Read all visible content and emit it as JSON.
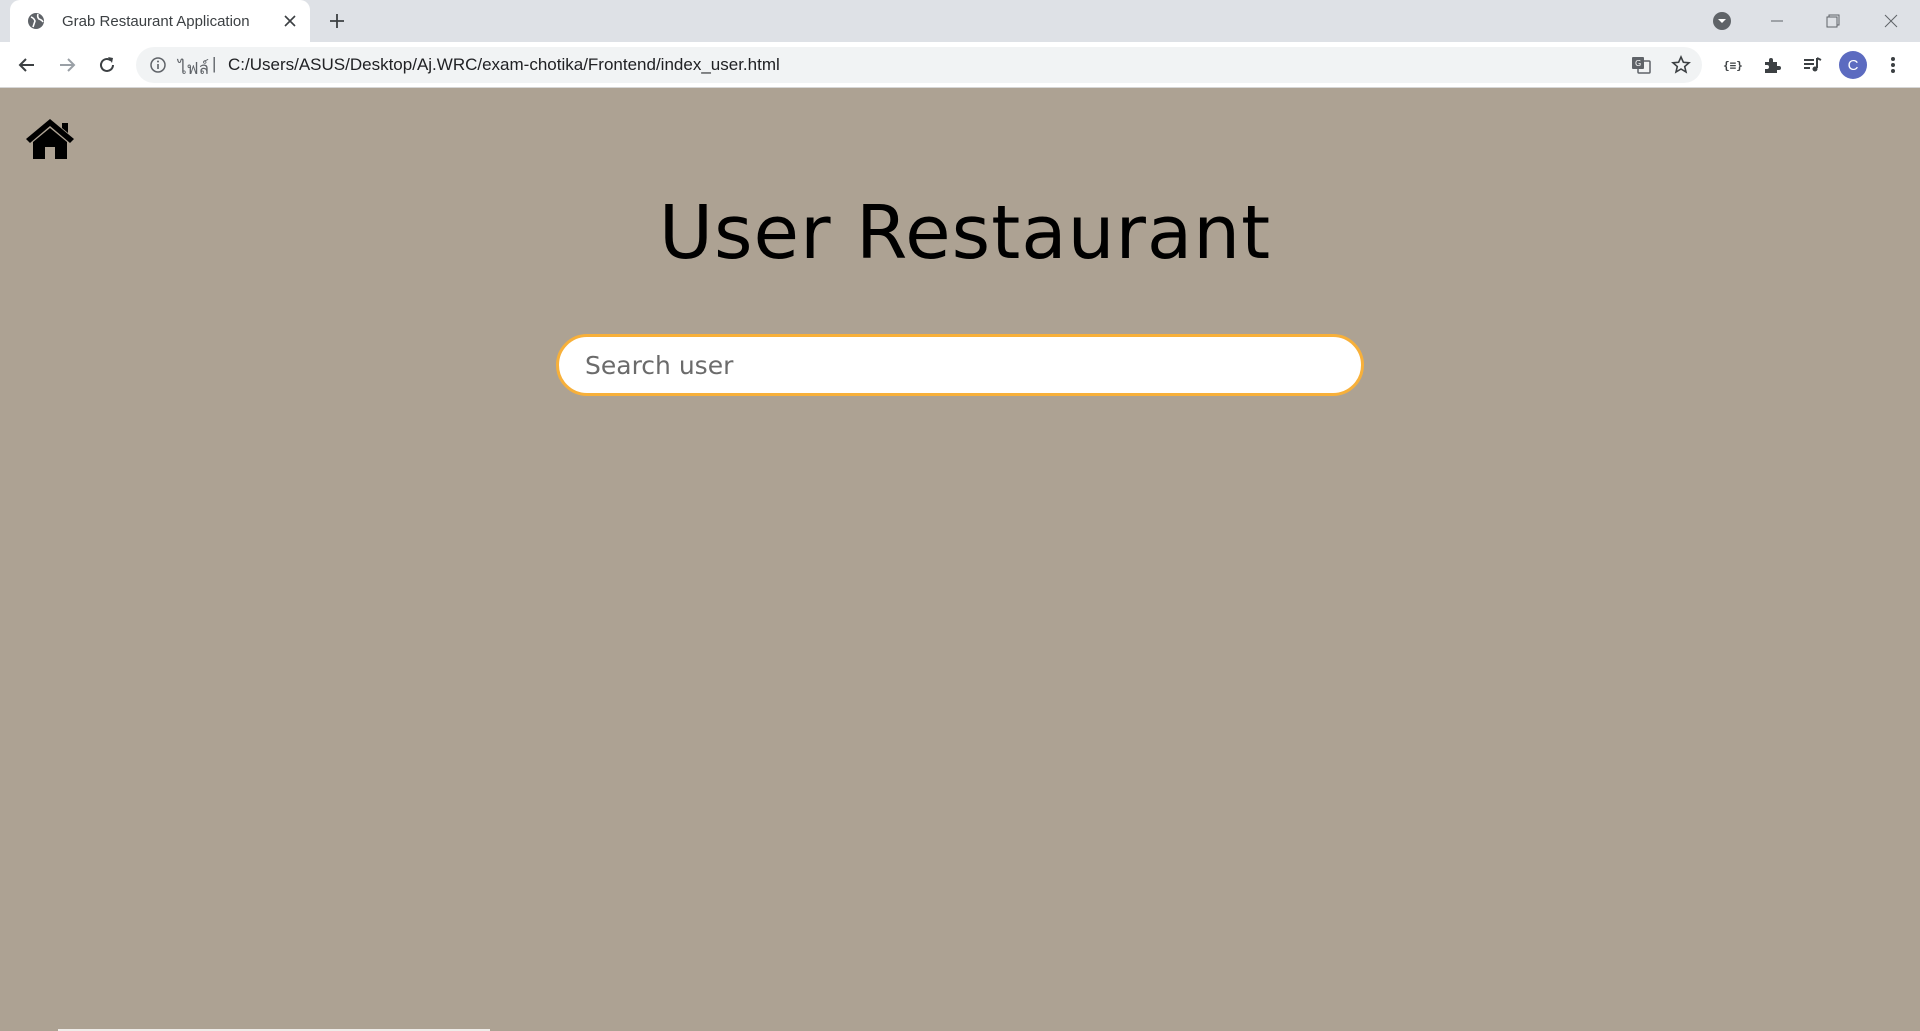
{
  "browser": {
    "tab_title": "Grab Restaurant Application",
    "address": {
      "scheme_label": "ไฟล์",
      "separator": "|",
      "url": "C:/Users/ASUS/Desktop/Aj.WRC/exam-chotika/Frontend/index_user.html"
    },
    "profile_initial": "C"
  },
  "page": {
    "title": "User Restaurant",
    "search": {
      "placeholder": "Search user",
      "value": ""
    }
  },
  "colors": {
    "page_background": "#ada293",
    "search_border": "#f7b03a",
    "avatar": "#5c6bc0"
  },
  "icons": {
    "home": "home-icon",
    "tab_favicon": "globe-icon"
  }
}
